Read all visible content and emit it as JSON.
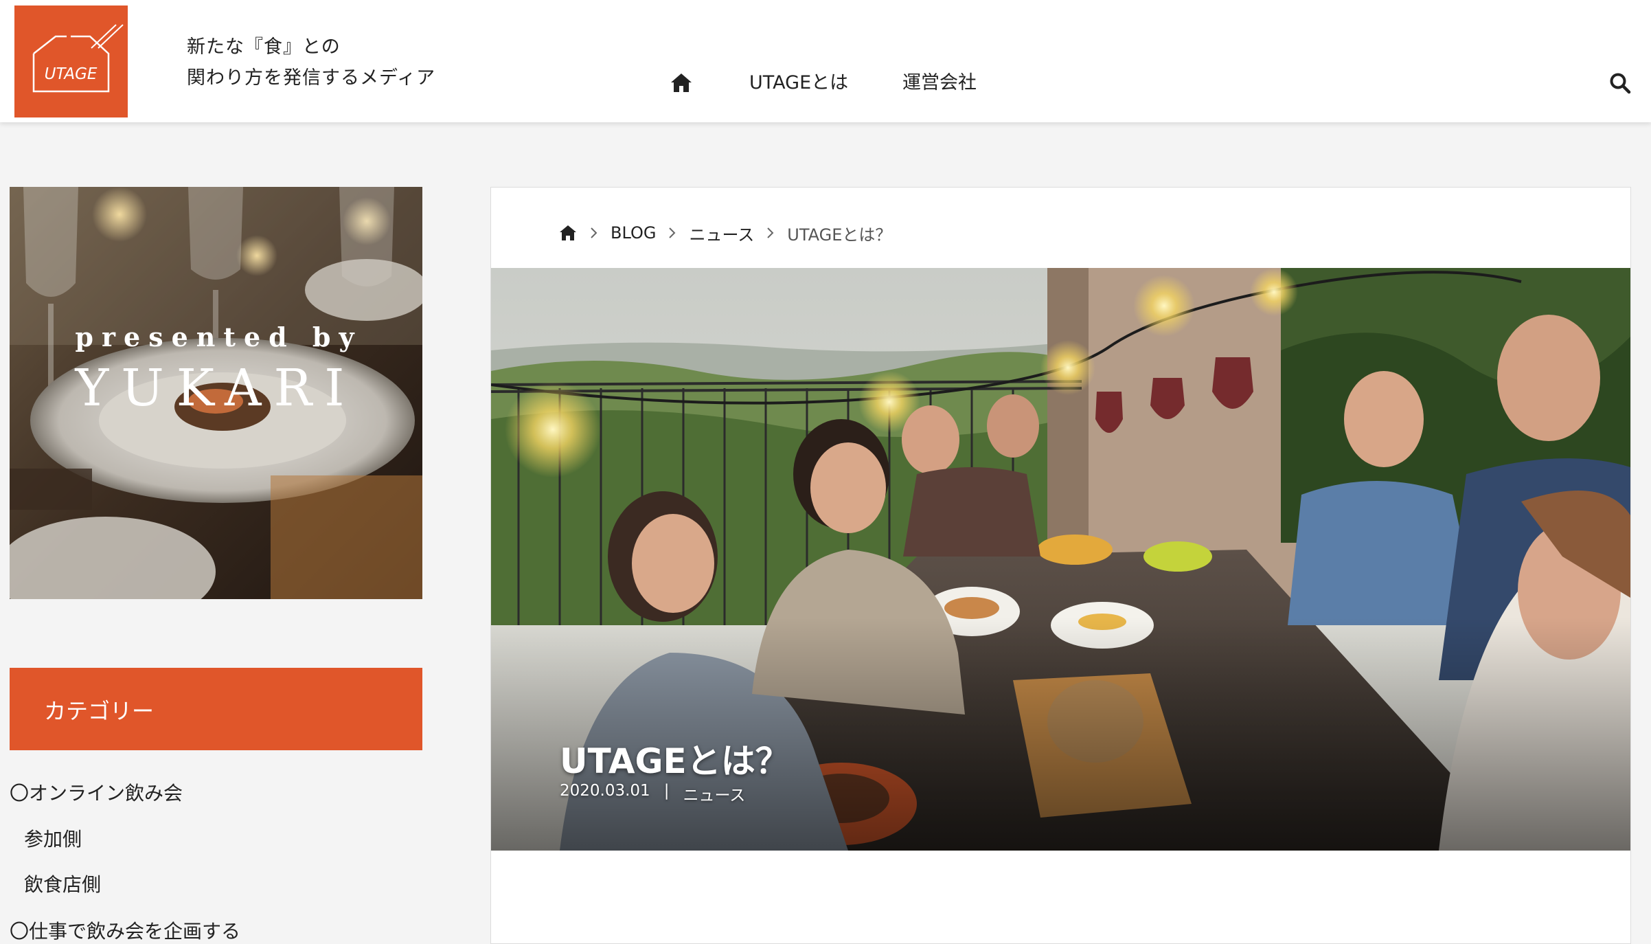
{
  "colors": {
    "accent": "#e0562a",
    "header_bg": "#ffffff",
    "page_bg": "#f4f4f4",
    "text": "#222222"
  },
  "header": {
    "logo_text": "UTAGE",
    "tagline_line1": "新たな『食』との",
    "tagline_line2": "関わり方を発信するメディア",
    "nav": {
      "home_icon": "home-icon",
      "items": [
        "UTAGEとは",
        "運営会社"
      ]
    },
    "search_icon": "search-icon"
  },
  "sidebar": {
    "banner": {
      "line1": "presented by",
      "line2": "YUKARI"
    },
    "category_heading": "カテゴリー",
    "categories": [
      "〇オンライン飲み会",
      "参加側",
      "飲食店側",
      "〇仕事で飲み会を企画する"
    ]
  },
  "article": {
    "breadcrumb": {
      "home_icon": "home-icon",
      "items": [
        "BLOG",
        "ニュース"
      ],
      "current": "UTAGEとは？"
    },
    "hero": {
      "title": "UTAGEとは？",
      "date": "2020.03.01",
      "separator": "|",
      "category": "ニュース"
    }
  }
}
